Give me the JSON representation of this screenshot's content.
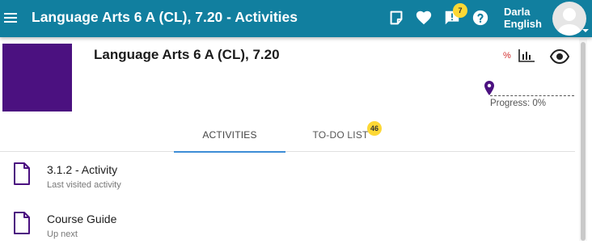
{
  "topbar": {
    "title": "Language Arts 6 A (CL), 7.20 - Activities",
    "notifications_count": "7",
    "user_first": "Darla",
    "user_last": "English",
    "icons": [
      "menu-icon",
      "sticky-note-icon",
      "heart-icon",
      "alert-comment-icon",
      "help-icon",
      "avatar",
      "chevron-down-icon"
    ]
  },
  "course": {
    "title": "Language Arts 6 A (CL), 7.20",
    "image_color": "#4b1180",
    "percent_icon_label": "%",
    "progress_value": 0,
    "progress_label": "Progress: 0%"
  },
  "tabs": {
    "activities_label": "ACTIVITIES",
    "todo_label": "TO-DO LIST",
    "todo_count": "46"
  },
  "activities": [
    {
      "title": "3.1.2 - Activity",
      "subtitle": "Last visited activity"
    },
    {
      "title": "Course Guide",
      "subtitle": "Up next"
    }
  ],
  "colors": {
    "topbar": "#117f9f",
    "course_accent": "#4b1180",
    "badge": "#fdd835",
    "tab_underline": "#3d8dd6",
    "percent_icon": "#d32f2f"
  }
}
